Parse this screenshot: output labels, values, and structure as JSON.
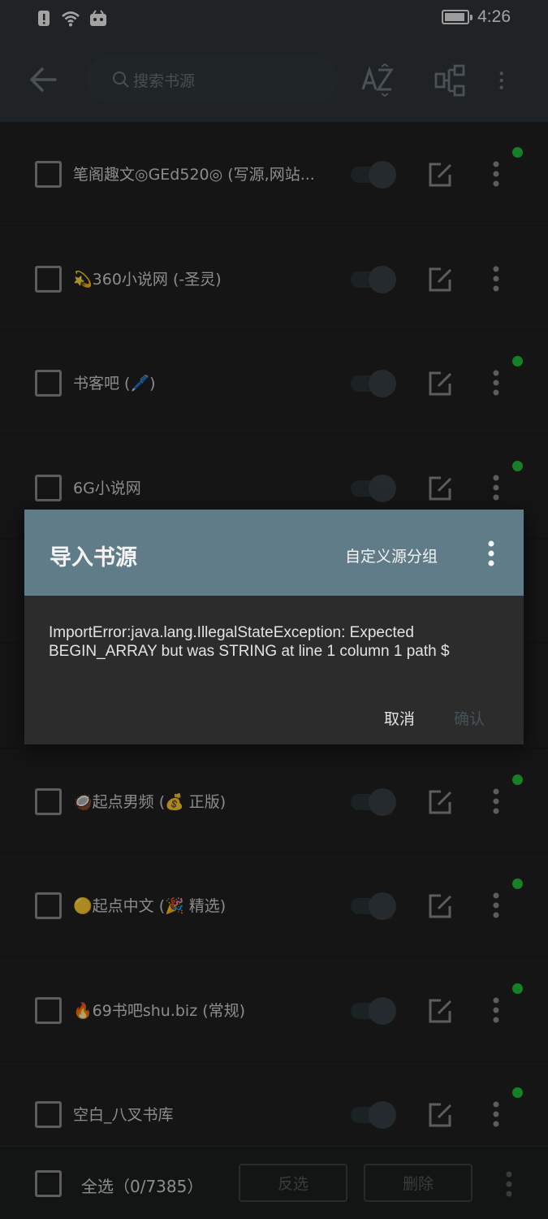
{
  "status_bar": {
    "time": "4:26",
    "battery_level": 0.9,
    "icons": [
      "alert-icon",
      "wifi-icon",
      "app-notification-icon",
      "battery-icon"
    ]
  },
  "toolbar": {
    "back_icon": "arrow-left-icon",
    "search_placeholder": "搜索书源",
    "sort_icon": "az-sort-icon",
    "group_icon": "source-group-icon",
    "more_icon": "more-vertical-icon"
  },
  "sources": [
    {
      "title": "笔阁趣文◎GEd520◎ (写源,网站...",
      "enabled": true,
      "status_dot": true
    },
    {
      "title": "💫360小说网 (-圣灵)",
      "enabled": true,
      "status_dot": false
    },
    {
      "title": "书客吧 (🖊️)",
      "enabled": true,
      "status_dot": true
    },
    {
      "title": "6G小说网",
      "enabled": true,
      "status_dot": true
    },
    {
      "title": "",
      "enabled": true,
      "status_dot": false
    },
    {
      "title": "",
      "enabled": true,
      "status_dot": false
    },
    {
      "title": "🥥起点男频 (💰 正版)",
      "enabled": true,
      "status_dot": true
    },
    {
      "title": "🟡起点中文 (🎉 精选)",
      "enabled": true,
      "status_dot": true
    },
    {
      "title": "🔥69书吧shu.biz (常规)",
      "enabled": true,
      "status_dot": true
    },
    {
      "title": "空白_八叉书库",
      "enabled": true,
      "status_dot": true
    }
  ],
  "bottom_bar": {
    "select_all_label": "全选（0/7385）",
    "invert_label": "反选",
    "delete_label": "删除"
  },
  "dialog": {
    "title": "导入书源",
    "custom_group_label": "自定义源分组",
    "message": "ImportError:java.lang.IllegalStateException: Expected BEGIN_ARRAY but was STRING at line 1 column 1 path $",
    "cancel_label": "取消",
    "confirm_label": "确认"
  },
  "colors": {
    "toolbar_bg": "#2e3438",
    "list_bg": "#1f1f1f",
    "dialog_header": "#5f7c88",
    "dialog_body": "#2c2c2c",
    "status_dot": "#1fbf3a"
  }
}
